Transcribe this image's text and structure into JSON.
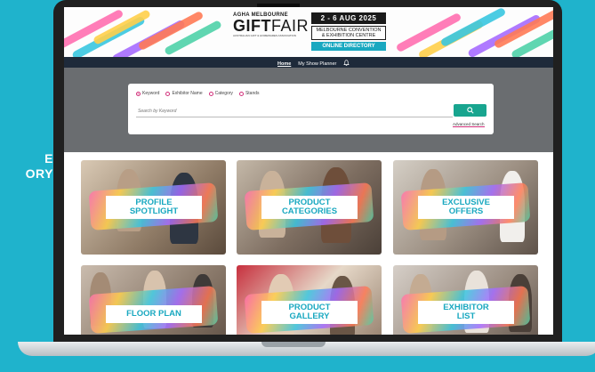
{
  "side_text": [
    "E",
    "ORY"
  ],
  "banner": {
    "logo_top": "AGHA MELBOURNE",
    "logo_main_bold": "GIFT",
    "logo_main_light": "FAIR",
    "logo_tagline": "AUSTRALIAN GIFT & HOMEWARES ASSOCIATION",
    "dates": "2 - 6 AUG 2025",
    "venue_line1": "MELBOURNE CONVENTION",
    "venue_line2": "& EXHIBITION CENTRE",
    "online": "ONLINE DIRECTORY"
  },
  "nav": {
    "home": "Home",
    "planner": "My Show Planner"
  },
  "search": {
    "radios": [
      "Keyword",
      "Exhibitor Name",
      "Category",
      "Stands"
    ],
    "selected": "Keyword",
    "placeholder": "Search by Keyword",
    "button_icon": "search-icon",
    "advanced": "Advanced Search"
  },
  "tiles": {
    "profile": "PROFILE SPOTLIGHT",
    "profile_l1": "PROFILE",
    "profile_l2": "SPOTLIGHT",
    "categories_l1": "PRODUCT",
    "categories_l2": "CATEGORIES",
    "offers_l1": "EXCLUSIVE",
    "offers_l2": "OFFERS",
    "floor": "FLOOR PLAN",
    "gallery_l1": "PRODUCT",
    "gallery_l2": "GALLERY",
    "exhibitor_l1": "EXHIBITOR",
    "exhibitor_l2": "LIST"
  },
  "colors": {
    "page_bg": "#1fb3cc",
    "accent_teal": "#19a8c0",
    "accent_pink": "#d2307a",
    "search_button": "#18a58f",
    "nav_bg": "#1e2a3a"
  }
}
